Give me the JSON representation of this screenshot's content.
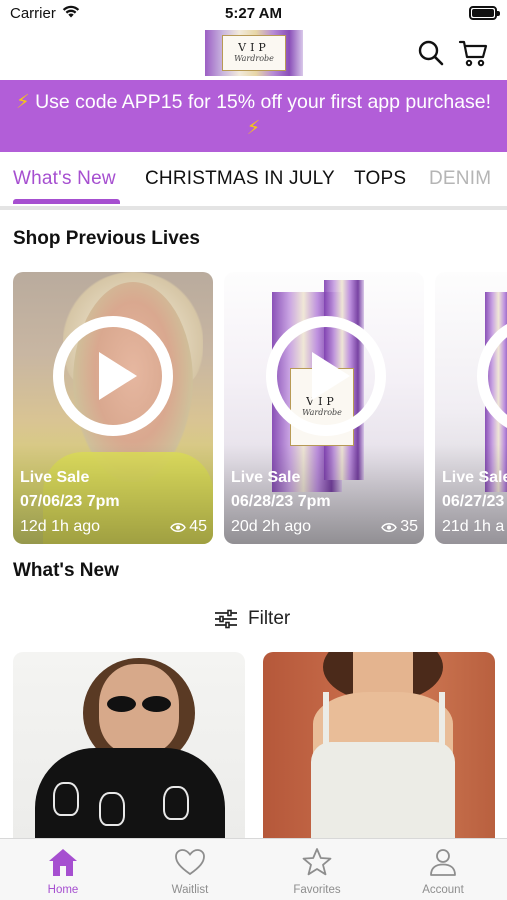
{
  "status_bar": {
    "carrier": "Carrier",
    "time": "5:27 AM",
    "battery_level": 1.0
  },
  "header": {
    "logo": {
      "line1": "VIP",
      "line2": "Wardrobe"
    },
    "icons": [
      "search-icon",
      "cart-icon"
    ]
  },
  "promo": {
    "icon": "lightning-bolt-icon",
    "text": "Use code APP15 for 15% off your first app purchase!"
  },
  "tabs": [
    {
      "label": "What's New",
      "active": true
    },
    {
      "label": "CHRISTMAS IN JULY",
      "active": false
    },
    {
      "label": "TOPS",
      "active": false
    },
    {
      "label": "DENIM",
      "active": false
    }
  ],
  "lives": {
    "title": "Shop Previous Lives",
    "cards": [
      {
        "label": "Live Sale",
        "date": "07/06/23 7pm",
        "ago": "12d 1h ago",
        "views": "45"
      },
      {
        "label": "Live Sale",
        "date": "06/28/23 7pm",
        "ago": "20d 2h ago",
        "views": "35"
      },
      {
        "label": "Live Sale",
        "date": "06/27/23",
        "ago": "21d 1h a",
        "views": ""
      }
    ]
  },
  "whats_new": {
    "title": "What's New",
    "filter_label": "Filter"
  },
  "colors": {
    "accent": "#a64fd0",
    "promo_bg": "#b25ed8",
    "bolt": "#f5c518"
  },
  "tabbar": [
    {
      "label": "Home",
      "icon": "home-icon",
      "active": true
    },
    {
      "label": "Waitlist",
      "icon": "heart-icon",
      "active": false
    },
    {
      "label": "Favorites",
      "icon": "star-icon",
      "active": false
    },
    {
      "label": "Account",
      "icon": "person-icon",
      "active": false
    }
  ]
}
